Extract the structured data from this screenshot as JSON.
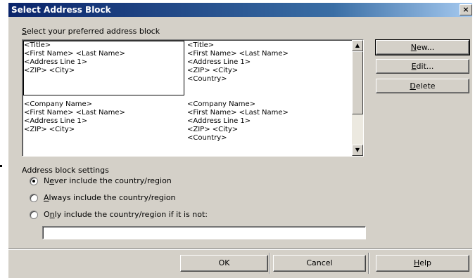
{
  "window": {
    "title": "Select Address Block",
    "close_glyph": "×"
  },
  "prompt": {
    "accel": "S",
    "rest": "elect your preferred address block"
  },
  "blocks": [
    {
      "text": "<Title>\n<First Name> <Last Name>\n<Address Line 1>\n<ZIP> <City>"
    },
    {
      "text": "<Title>\n<First Name> <Last Name>\n<Address Line 1>\n<ZIP> <City>\n<Country>"
    },
    {
      "text": "<Company Name>\n<First Name> <Last Name>\n<Address Line 1>\n<ZIP> <City>"
    },
    {
      "text": "<Company Name>\n<First Name> <Last Name>\n<Address Line 1>\n<ZIP> <City>\n<Country>"
    }
  ],
  "side_buttons": {
    "new": {
      "accel": "N",
      "rest": "ew..."
    },
    "edit": {
      "accel": "E",
      "rest": "dit..."
    },
    "delete": {
      "accel": "D",
      "rest": "elete"
    }
  },
  "settings": {
    "label": "Address block settings",
    "options": [
      {
        "pre": "N",
        "accel": "e",
        "rest": "ver include the country/region",
        "selected": true
      },
      {
        "pre": "",
        "accel": "A",
        "rest": "lways include the country/region",
        "selected": false
      },
      {
        "pre": "O",
        "accel": "n",
        "rest": "ly include the country/region if it is not:",
        "selected": false
      }
    ],
    "country_value": ""
  },
  "footer": {
    "ok": "OK",
    "cancel": "Cancel",
    "help": {
      "accel": "H",
      "rest": "elp"
    }
  }
}
